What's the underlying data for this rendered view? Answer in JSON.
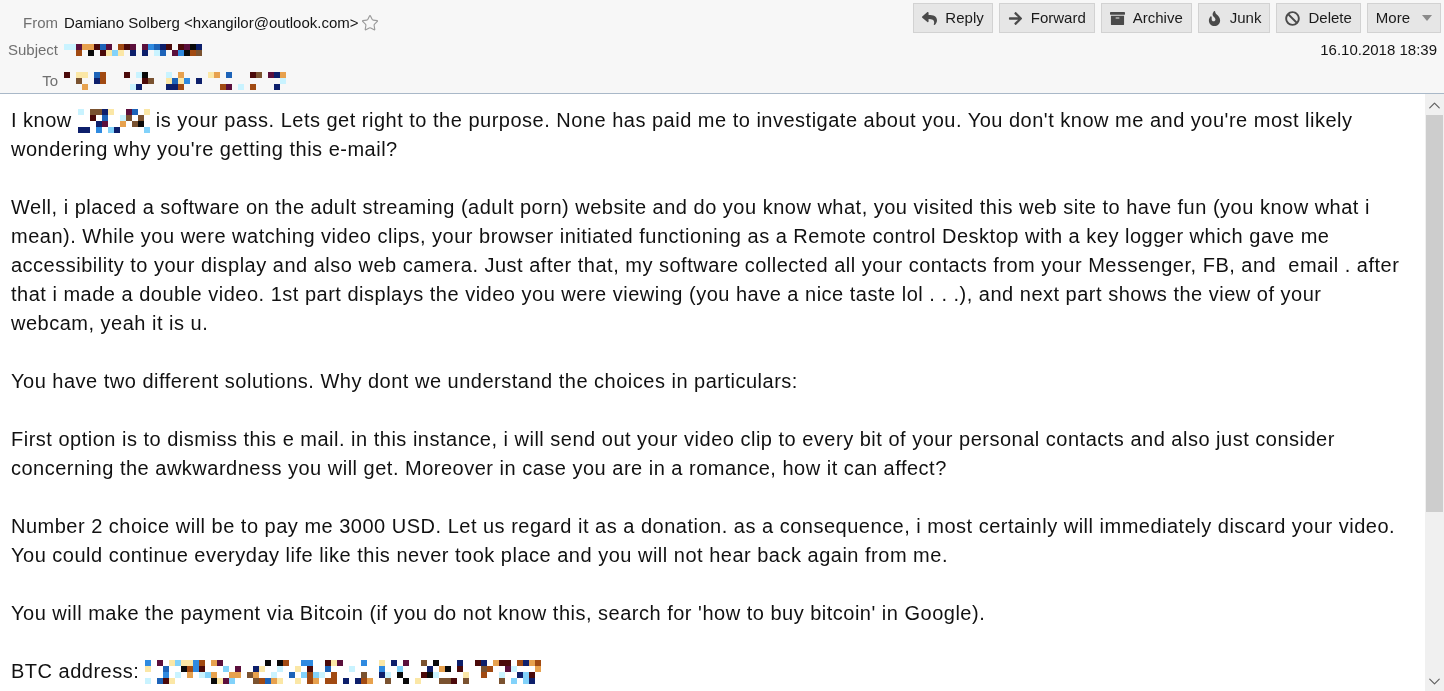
{
  "header": {
    "fields": [
      {
        "label": "From",
        "value": {
          "kind": "text",
          "text": "Damiano Solberg <hxangilor@outlook.com>"
        },
        "starred": false
      },
      {
        "label": "Subject",
        "value": {
          "kind": "redacted"
        }
      },
      {
        "label": "To",
        "value": {
          "kind": "redacted"
        }
      }
    ],
    "toolbar": [
      {
        "kind": "reply",
        "label": "Reply"
      },
      {
        "kind": "forward",
        "label": "Forward"
      },
      {
        "kind": "archive",
        "label": "Archive"
      },
      {
        "kind": "junk",
        "label": "Junk"
      },
      {
        "kind": "delete",
        "label": "Delete"
      },
      {
        "kind": "menu",
        "label": "More"
      }
    ],
    "date": "16.10.2018 18:39"
  },
  "body": {
    "paragraphs": [
      {
        "kind": "mixed",
        "lines": [
          [
            {
              "kind": "text",
              "text": "I know"
            },
            {
              "kind": "redacted"
            },
            {
              "kind": "text",
              "text": "is your pass. Lets get right to the purpose. None has paid me to investigate about you. You don't know me and you're most likely"
            }
          ],
          [
            {
              "kind": "text",
              "text": "wondering why you're getting this e-mail?"
            }
          ]
        ]
      },
      {
        "kind": "plain",
        "text": "Well, i placed a software on the adult streaming (adult porn) website and do you know what, you visited this web site to have fun (you know what i mean). While you were watching video clips, your browser initiated functioning as a Remote control Desktop with a key logger which gave me accessibility to your display and also web camera. Just after that, my software collected all your contacts from your Messenger, FB, and  email . after that i made a double video. 1st part displays the video you were viewing (you have a nice taste lol . . .), and next part shows the view of your webcam, yeah it is u."
      },
      {
        "kind": "plain",
        "text": "You have two different solutions. Why dont we understand the choices in particulars:"
      },
      {
        "kind": "plain",
        "text": "First option is to dismiss this e mail. in this instance, i will send out your video clip to every bit of your personal contacts and also just consider concerning the awkwardness you will get. Moreover in case you are in a romance, how it can affect?"
      },
      {
        "kind": "plain",
        "text": "Number 2 choice will be to pay me 3000 USD. Let us regard it as a donation. as a consequence, i most certainly will immediately discard your video. You could continue everyday life like this never took place and you will not hear back again from me."
      },
      {
        "kind": "plain",
        "text": "You will make the payment via Bitcoin (if you do not know this, search for 'how to buy bitcoin' in Google)."
      },
      {
        "kind": "mixed",
        "lines": [
          [
            {
              "kind": "text",
              "text": "BTC address:"
            },
            {
              "kind": "redacted"
            }
          ]
        ]
      }
    ]
  }
}
